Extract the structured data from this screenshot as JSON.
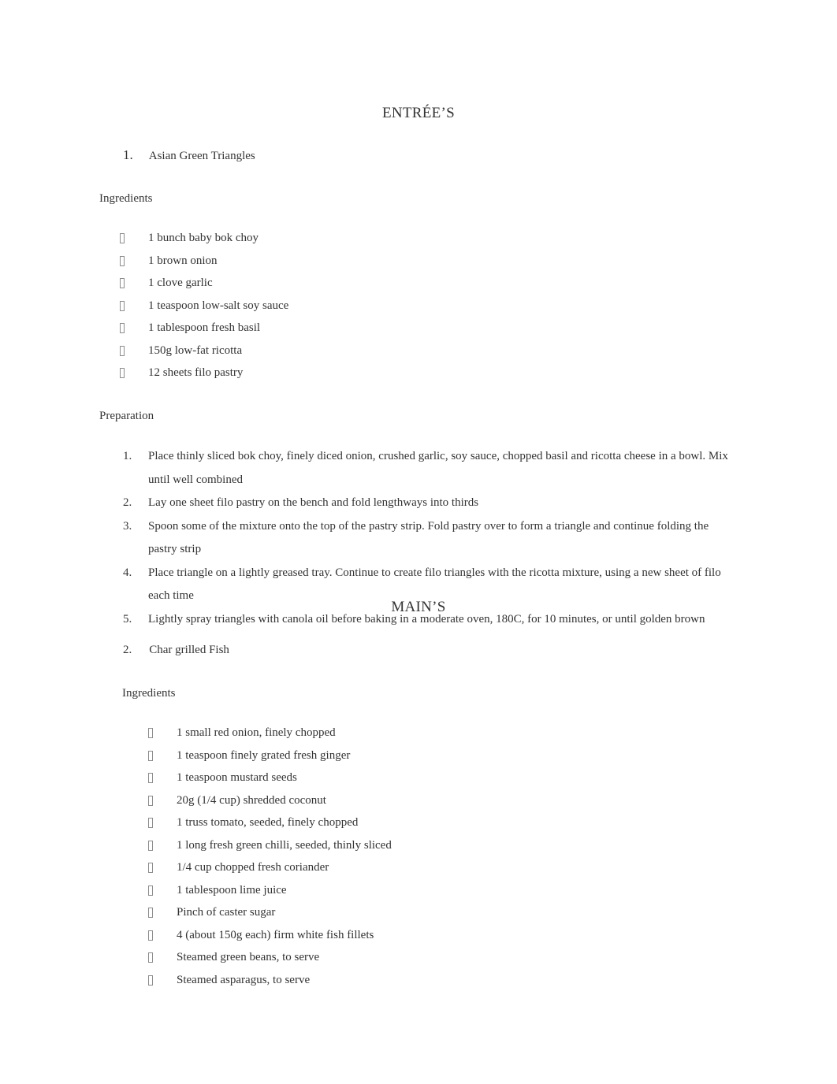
{
  "document": {
    "text_color": "#333333",
    "background_color": "#ffffff",
    "bullet_glyph": "missing-glyph-box"
  },
  "sections": [
    {
      "heading": "ENTRÉE’S",
      "recipe_number": "1.",
      "recipe_title": "Asian Green Triangles",
      "ingredients_label": "Ingredients",
      "ingredients": [
        "1 bunch baby bok choy",
        "1 brown onion",
        "1 clove garlic",
        "1 teaspoon low-salt soy sauce",
        "1 tablespoon fresh basil",
        "150g low-fat ricotta",
        "12 sheets filo pastry"
      ],
      "preparation_label": "Preparation",
      "preparation_steps": [
        {
          "number": "1.",
          "text": "Place thinly sliced bok choy, finely diced onion, crushed garlic, soy sauce, chopped basil and ricotta cheese in a bowl. Mix until well combined"
        },
        {
          "number": "2.",
          "text": "Lay one sheet filo pastry on the bench and fold lengthways into thirds"
        },
        {
          "number": "3.",
          "text": "Spoon some of the mixture onto the top of the pastry strip. Fold pastry over to form a triangle and continue folding the pastry strip"
        },
        {
          "number": "4.",
          "text": "Place triangle on a lightly greased tray. Continue to create filo triangles with the ricotta mixture, using a new sheet of filo each time"
        },
        {
          "number": "5.",
          "text": "Lightly spray triangles with canola oil before baking in a moderate oven, 180C, for 10 minutes, or until golden brown"
        }
      ]
    },
    {
      "heading": "MAIN’S",
      "recipe_number": "2.",
      "recipe_title": "Char grilled Fish",
      "ingredients_label": "Ingredients",
      "ingredients": [
        "1 small red onion, finely chopped",
        "1 teaspoon finely grated fresh ginger",
        "1 teaspoon mustard seeds",
        "20g (1/4 cup) shredded coconut",
        "1 truss tomato, seeded, finely chopped",
        "1 long fresh green chilli, seeded, thinly sliced",
        "1/4 cup chopped fresh coriander",
        "1 tablespoon lime juice",
        "Pinch of caster sugar",
        "4 (about 150g each) firm white fish fillets",
        "Steamed green beans, to serve",
        "Steamed asparagus, to serve"
      ]
    }
  ]
}
